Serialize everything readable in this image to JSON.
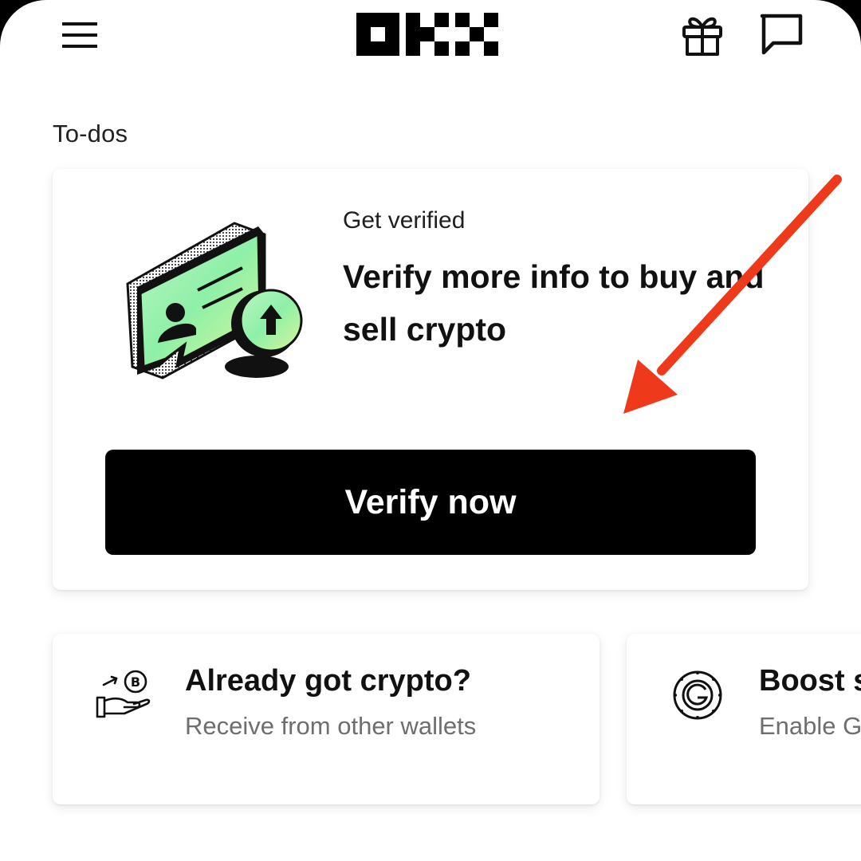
{
  "header": {
    "menu_icon": "hamburger-menu-icon",
    "logo_text": "OKX",
    "gift_icon": "gift-icon",
    "chat_icon": "chat-bubble-icon"
  },
  "section": {
    "title": "To-dos"
  },
  "verify_card": {
    "kicker": "Get verified",
    "heading": "Verify more info to buy and sell crypto",
    "button_label": "Verify now",
    "illustration": "id-card-upload-illustration"
  },
  "mini_cards": [
    {
      "title": "Already got crypto?",
      "subtitle": "Receive from other wallets",
      "icon": "hand-receive-coin-icon"
    },
    {
      "title": "Boost s",
      "subtitle": "Enable G",
      "icon": "google-authenticator-icon"
    }
  ],
  "annotation": {
    "arrow_color": "#EE3A1B"
  },
  "colors": {
    "accent_green": "#8EF0A8",
    "button_bg": "#000000"
  }
}
